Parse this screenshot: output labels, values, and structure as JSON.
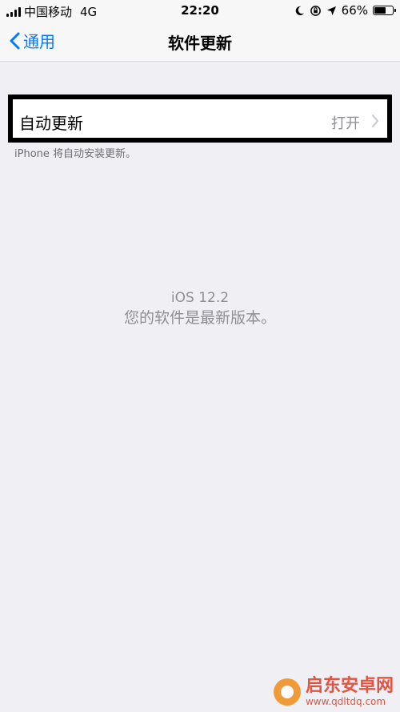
{
  "status_bar": {
    "carrier": "中国移动",
    "network": "4G",
    "time": "22:20",
    "battery": "66%",
    "battery_level": 0.66
  },
  "nav": {
    "back_label": "通用",
    "title": "软件更新"
  },
  "auto_update": {
    "label": "自动更新",
    "value": "打开"
  },
  "footer_note": "iPhone 将自动安装更新。",
  "status": {
    "version": "iOS 12.2",
    "message": "您的软件是最新版本。"
  },
  "watermark": {
    "name": "启东安卓网",
    "url": "www.qdltdq.com"
  },
  "colors": {
    "accent": "#007aff",
    "background": "#efeff4",
    "secondary_text": "#8e8e93",
    "watermark": "#e4533f"
  }
}
